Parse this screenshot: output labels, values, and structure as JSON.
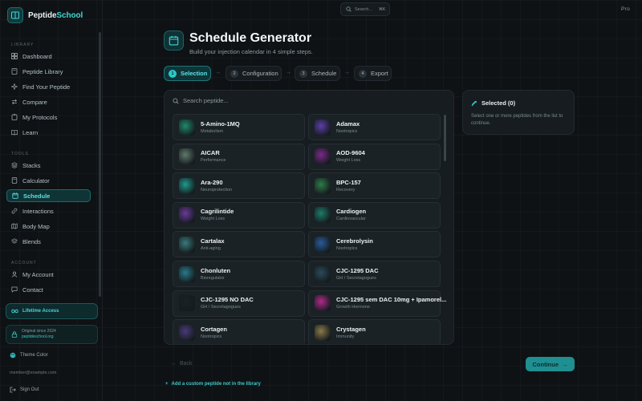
{
  "brand": {
    "name_part1": "Peptide",
    "name_part2": "School"
  },
  "sidebar": {
    "library_label": "LIBRARY",
    "library_items": [
      {
        "label": "Dashboard",
        "icon": "grid-icon"
      },
      {
        "label": "Peptide Library",
        "icon": "book-icon"
      },
      {
        "label": "Find Your Peptide",
        "icon": "sparkle-icon"
      },
      {
        "label": "Compare",
        "icon": "compare-icon"
      },
      {
        "label": "My Protocols",
        "icon": "clipboard-icon"
      },
      {
        "label": "Learn",
        "icon": "open-book-icon"
      }
    ],
    "tools_label": "TOOLS",
    "tools_items": [
      {
        "label": "Stacks",
        "icon": "layers-icon"
      },
      {
        "label": "Calculator",
        "icon": "calculator-icon"
      },
      {
        "label": "Schedule",
        "icon": "calendar-icon",
        "active": true
      },
      {
        "label": "Interactions",
        "icon": "link-icon"
      },
      {
        "label": "Body Map",
        "icon": "map-icon"
      },
      {
        "label": "Blends",
        "icon": "blend-icon"
      }
    ],
    "account_label": "ACCOUNT",
    "account_items": [
      {
        "label": "My Account",
        "icon": "user-icon"
      },
      {
        "label": "Contact",
        "icon": "message-icon"
      }
    ],
    "lifetime_label": "Lifetime Access",
    "original_line1": "Original since 2024",
    "original_line2": "peptideschool.org",
    "theme_label": "Theme Color",
    "email": "member@example.com",
    "signout_label": "Sign Out"
  },
  "topbar": {
    "search_placeholder": "Search...",
    "search_shortcut": "⌘K",
    "plan_badge": "Pro"
  },
  "header": {
    "title": "Schedule Generator",
    "subtitle": "Build your injection calendar in 4 simple steps."
  },
  "steps": [
    {
      "num": "1",
      "label": "Selection",
      "active": true
    },
    {
      "num": "2",
      "label": "Configuration"
    },
    {
      "num": "3",
      "label": "Schedule"
    },
    {
      "num": "4",
      "label": "Export"
    }
  ],
  "peptide_search": {
    "placeholder": "Search peptide..."
  },
  "peptides": [
    {
      "name": "5-Amino-1MQ",
      "category": "Metabolism",
      "color": "#1e8a6a"
    },
    {
      "name": "Adamax",
      "category": "Nootropics",
      "color": "#5b3fa8"
    },
    {
      "name": "AICAR",
      "category": "Performance",
      "color": "#5f7a6c"
    },
    {
      "name": "AOD-9604",
      "category": "Weight Loss",
      "color": "#7a2a8a"
    },
    {
      "name": "Ara-290",
      "category": "Neuroprotection",
      "color": "#1f9a8c"
    },
    {
      "name": "BPC-157",
      "category": "Recovery",
      "color": "#2f7a4a"
    },
    {
      "name": "Cagrilintide",
      "category": "Weight Loss",
      "color": "#6a3a9a"
    },
    {
      "name": "Cardiogen",
      "category": "Cardiovascular",
      "color": "#1f7a6a"
    },
    {
      "name": "Cartalax",
      "category": "Anti-aging",
      "color": "#3a7a7a"
    },
    {
      "name": "Cerebrolysin",
      "category": "Nootropics",
      "color": "#2a5a9a"
    },
    {
      "name": "Chonluten",
      "category": "Bioregulator",
      "color": "#2a7a8a"
    },
    {
      "name": "CJC-1295 DAC",
      "category": "GH / Secretagogues",
      "color": "#2a4a5a"
    },
    {
      "name": "CJC-1295 NO DAC",
      "category": "GH / Secretagogues",
      "color": "#1b2226"
    },
    {
      "name": "CJC-1295 sem DAC 10mg + Ipamorel...",
      "category": "Growth Hormone",
      "color": "#b02a8a"
    },
    {
      "name": "Cortagen",
      "category": "Nootropics",
      "color": "#4a3a7a"
    },
    {
      "name": "Crystagen",
      "category": "Immunity",
      "color": "#8a7a4a"
    }
  ],
  "selected": {
    "title": "Selected (0)",
    "description": "Select one or more peptides from the list to continue."
  },
  "actions": {
    "back_label": "Back",
    "continue_label": "Continue",
    "add_custom_label": "Add a custom peptide not in the library"
  },
  "colors": {
    "accent": "#3fd6d8",
    "background": "#0e1214",
    "panel": "#161c1f"
  }
}
